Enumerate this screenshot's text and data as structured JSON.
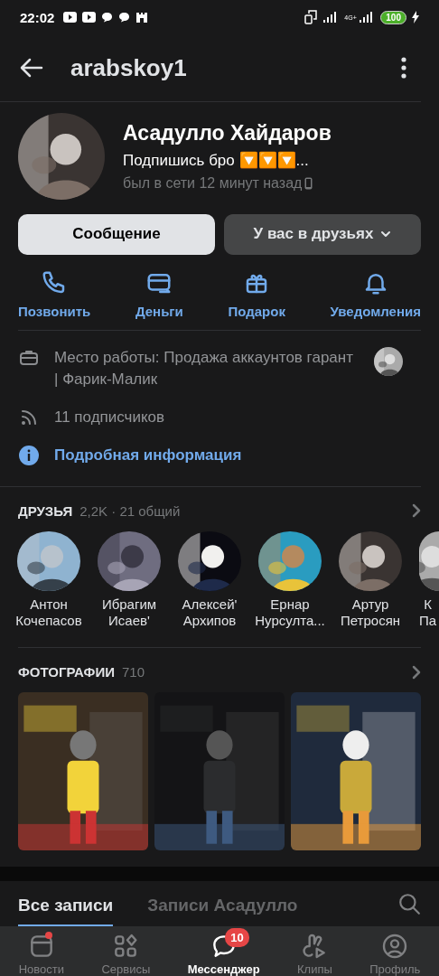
{
  "status_bar": {
    "time": "22:02",
    "network": "4G+",
    "battery": "100"
  },
  "header": {
    "title": "arabskoy1"
  },
  "profile": {
    "name": "Асадулло Хайдаров",
    "status": "Подпишись бро 🔽🔽🔽...",
    "last_seen": "был в сети 12 минут назад"
  },
  "buttons": [
    {
      "label": "Сообщение",
      "kind": "primary"
    },
    {
      "label": "У вас в друзьях",
      "kind": "dropdown"
    }
  ],
  "actions": [
    {
      "label": "Позвонить",
      "kind": "phone"
    },
    {
      "label": "Деньги",
      "kind": "money"
    },
    {
      "label": "Подарок",
      "kind": "gift"
    },
    {
      "label": "Уведомления",
      "kind": "bell"
    }
  ],
  "info": [
    {
      "kind": "work",
      "text": "Место работы: Продажа аккаунтов гарант | Фарик-Малик"
    },
    {
      "kind": "followers",
      "text": "11 подписчиков"
    },
    {
      "kind": "link",
      "text": "Подробная информация"
    }
  ],
  "friends": {
    "title": "ДРУЗЬЯ",
    "count": "2,2K · 21 общий",
    "items": [
      {
        "first": "Антон",
        "last": "Кочепасов"
      },
      {
        "first": "Ибрагим",
        "last": "Исаев'"
      },
      {
        "first": "Алексей'",
        "last": "Архипов"
      },
      {
        "first": "Ернар",
        "last": "Нурсулта..."
      },
      {
        "first": "Артур",
        "last": "Петросян"
      },
      {
        "first": "К",
        "last": "Па"
      }
    ]
  },
  "photos": {
    "title": "ФОТОГРАФИИ",
    "count": "710"
  },
  "wall_tabs": [
    {
      "label": "Все записи",
      "selected": true
    },
    {
      "label": "Записи Асадулло",
      "selected": false
    }
  ],
  "nav": [
    {
      "label": "Новости",
      "kind": "news",
      "selected": false,
      "dot": true
    },
    {
      "label": "Сервисы",
      "kind": "services",
      "selected": false,
      "dot": false
    },
    {
      "label": "Мессенджер",
      "kind": "messenger",
      "selected": true,
      "dot": false,
      "badge": "10"
    },
    {
      "label": "Клипы",
      "kind": "clips",
      "selected": false,
      "dot": false
    },
    {
      "label": "Профиль",
      "kind": "profile",
      "selected": false,
      "dot": false
    }
  ]
}
